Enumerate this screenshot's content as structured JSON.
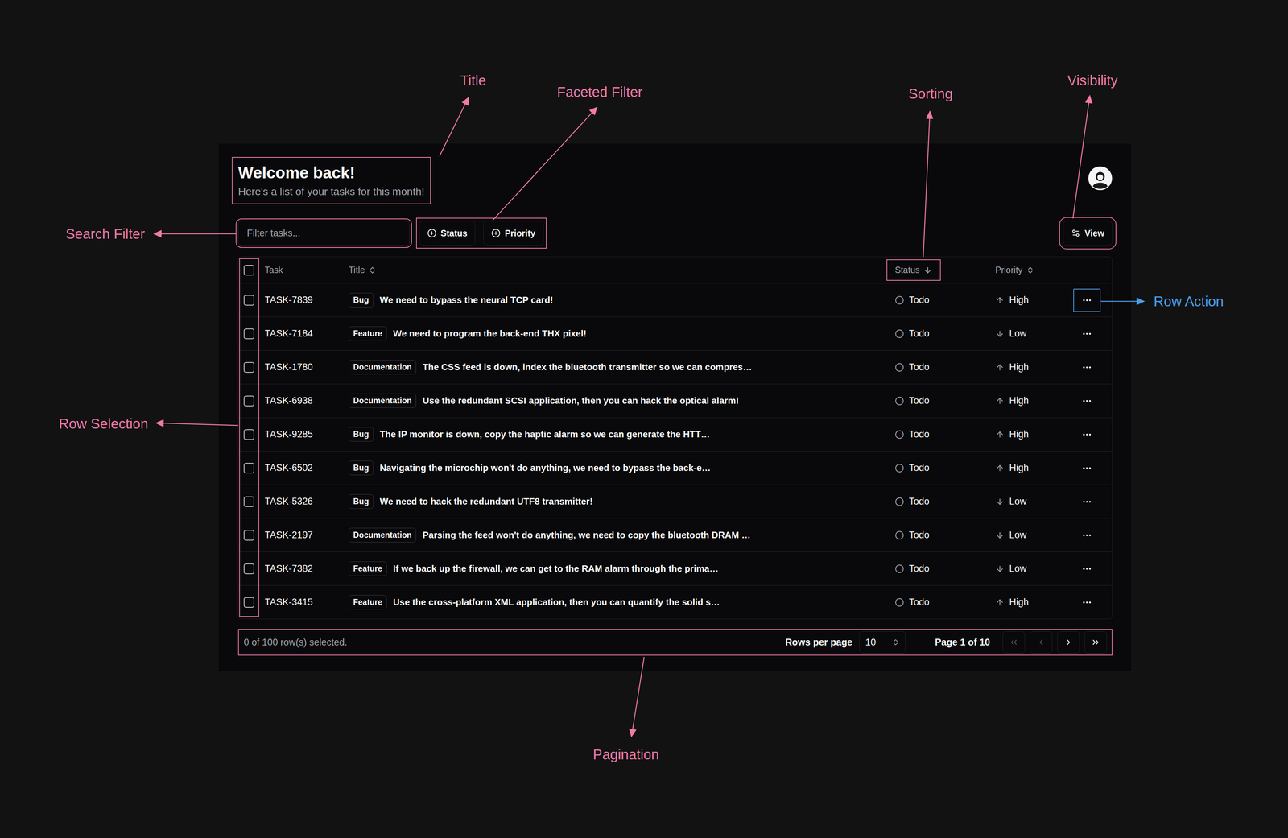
{
  "annotations": [
    {
      "label": "Title",
      "color": "#f27aa8"
    },
    {
      "label": "Faceted Filter",
      "color": "#f27aa8"
    },
    {
      "label": "Sorting",
      "color": "#f27aa8"
    },
    {
      "label": "Visibility",
      "color": "#f27aa8"
    },
    {
      "label": "Search Filter",
      "color": "#f27aa8"
    },
    {
      "label": "Row Action",
      "color": "#4a9eea"
    },
    {
      "label": "Row Selection",
      "color": "#f27aa8"
    },
    {
      "label": "Pagination",
      "color": "#f27aa8"
    }
  ],
  "header": {
    "title": "Welcome back!",
    "subtitle": "Here's a list of your tasks for this month!"
  },
  "search": {
    "placeholder": "Filter tasks..."
  },
  "filters": [
    "Status",
    "Priority"
  ],
  "view_button": "View",
  "table": {
    "all_selected": false,
    "columns": [
      {
        "label": "Task",
        "sort": "none"
      },
      {
        "label": "Title",
        "sort": "both"
      },
      {
        "label": "Status",
        "sort": "desc"
      },
      {
        "label": "Priority",
        "sort": "both"
      }
    ],
    "rows": [
      {
        "id": "TASK-7839",
        "label": "Bug",
        "title": "We need to bypass the neural TCP card!",
        "status": "Todo",
        "priority": "High",
        "priority_kind": "up",
        "selected": false
      },
      {
        "id": "TASK-7184",
        "label": "Feature",
        "title": "We need to program the back-end THX pixel!",
        "status": "Todo",
        "priority": "Low",
        "priority_kind": "down",
        "selected": false
      },
      {
        "id": "TASK-1780",
        "label": "Documentation",
        "title": "The CSS feed is down, index the bluetooth transmitter so we can compres…",
        "status": "Todo",
        "priority": "High",
        "priority_kind": "up",
        "selected": false
      },
      {
        "id": "TASK-6938",
        "label": "Documentation",
        "title": "Use the redundant SCSI application, then you can hack the optical alarm!",
        "status": "Todo",
        "priority": "High",
        "priority_kind": "up",
        "selected": false
      },
      {
        "id": "TASK-9285",
        "label": "Bug",
        "title": "The IP monitor is down, copy the haptic alarm so we can generate the HTT…",
        "status": "Todo",
        "priority": "High",
        "priority_kind": "up",
        "selected": false
      },
      {
        "id": "TASK-6502",
        "label": "Bug",
        "title": "Navigating the microchip won't do anything, we need to bypass the back-e…",
        "status": "Todo",
        "priority": "High",
        "priority_kind": "up",
        "selected": false
      },
      {
        "id": "TASK-5326",
        "label": "Bug",
        "title": "We need to hack the redundant UTF8 transmitter!",
        "status": "Todo",
        "priority": "Low",
        "priority_kind": "down",
        "selected": false
      },
      {
        "id": "TASK-2197",
        "label": "Documentation",
        "title": "Parsing the feed won't do anything, we need to copy the bluetooth DRAM …",
        "status": "Todo",
        "priority": "Low",
        "priority_kind": "down",
        "selected": false
      },
      {
        "id": "TASK-7382",
        "label": "Feature",
        "title": "If we back up the firewall, we can get to the RAM alarm through the prima…",
        "status": "Todo",
        "priority": "Low",
        "priority_kind": "down",
        "selected": false
      },
      {
        "id": "TASK-3415",
        "label": "Feature",
        "title": "Use the cross-platform XML application, then you can quantify the solid s…",
        "status": "Todo",
        "priority": "High",
        "priority_kind": "up",
        "selected": false
      }
    ]
  },
  "footer": {
    "selection": "0 of 100 row(s) selected.",
    "rows_per_page_label": "Rows per page",
    "rows_per_page": "10",
    "page": "Page 1 of 10",
    "nav": [
      {
        "kind": "first",
        "disabled": true
      },
      {
        "kind": "prev",
        "disabled": true
      },
      {
        "kind": "next",
        "disabled": false
      },
      {
        "kind": "last",
        "disabled": false
      }
    ]
  }
}
